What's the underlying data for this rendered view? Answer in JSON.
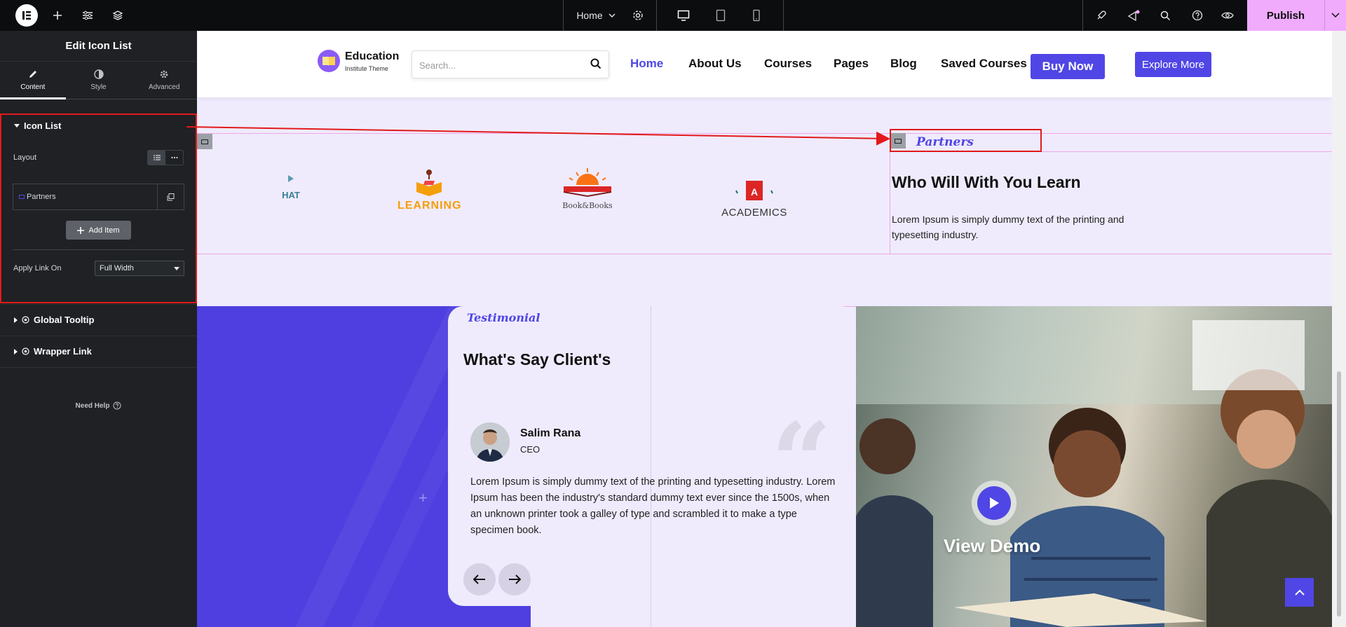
{
  "topbar": {
    "page_selector": "Home",
    "publish_label": "Publish"
  },
  "panel": {
    "title": "Edit Icon List",
    "tabs": [
      {
        "label": "Content",
        "icon": "pencil-icon"
      },
      {
        "label": "Style",
        "icon": "contrast-icon"
      },
      {
        "label": "Advanced",
        "icon": "gear-icon"
      }
    ],
    "section_title": "Icon List",
    "layout_label": "Layout",
    "repeater_item": "Partners",
    "add_item_label": "Add Item",
    "apply_link_label": "Apply Link On",
    "apply_link_value": "Full Width",
    "global_tooltip": "Global Tooltip",
    "wrapper_link": "Wrapper Link",
    "need_help": "Need Help"
  },
  "site": {
    "brand_name": "Education",
    "brand_sub": "Institute Theme",
    "search_placeholder": "Search...",
    "nav": [
      "Home",
      "About Us",
      "Courses",
      "Pages",
      "Blog",
      "Saved Courses"
    ],
    "buy_now": "Buy Now",
    "explore_more": "Explore More"
  },
  "partners": {
    "label": "Partners",
    "logos": [
      "HAT",
      "LEARNING",
      "Book&Books",
      "ACADEMICS"
    ],
    "title": "Who Will With You Learn",
    "text": "Lorem Ipsum is simply dummy text of the printing and typesetting industry."
  },
  "testimonial": {
    "label": "Testimonial",
    "title": "What's Say Client's",
    "client_name": "Salim Rana",
    "client_role": "CEO",
    "text": "Lorem Ipsum is simply dummy text of the printing and typesetting industry. Lorem Ipsum has been the industry's standard dummy text ever since the 1500s, when an unknown printer took a galley of type and scrambled it to make a type specimen book.",
    "view_demo": "View Demo"
  },
  "colors": {
    "accent": "#4f46e5",
    "annotation": "#e3191b",
    "publish_bg": "#f0abfc"
  }
}
